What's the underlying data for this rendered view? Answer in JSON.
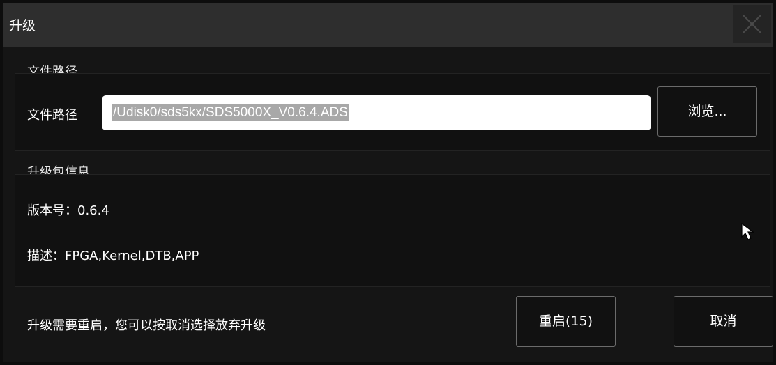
{
  "dialog": {
    "title": "升级",
    "close_icon": "close-icon"
  },
  "file_section": {
    "group_title": "文件路径",
    "field_label": "文件路径",
    "path_value": "/Udisk0/sds5kx/SDS5000X_V0.6.4.ADS",
    "browse_label": "浏览..."
  },
  "package_info": {
    "group_title": "升级包信息",
    "version_line": "版本号：0.6.4",
    "description_line": "描述：FPGA,Kernel,DTB,APP"
  },
  "footer": {
    "message": "升级需要重启，您可以按取消选择放弃升级",
    "restart_label": "重启(15)",
    "cancel_label": "取消"
  },
  "colors": {
    "background": "#151515",
    "titlebar": "#2e2e2e",
    "selection": "#a8a8a8"
  }
}
